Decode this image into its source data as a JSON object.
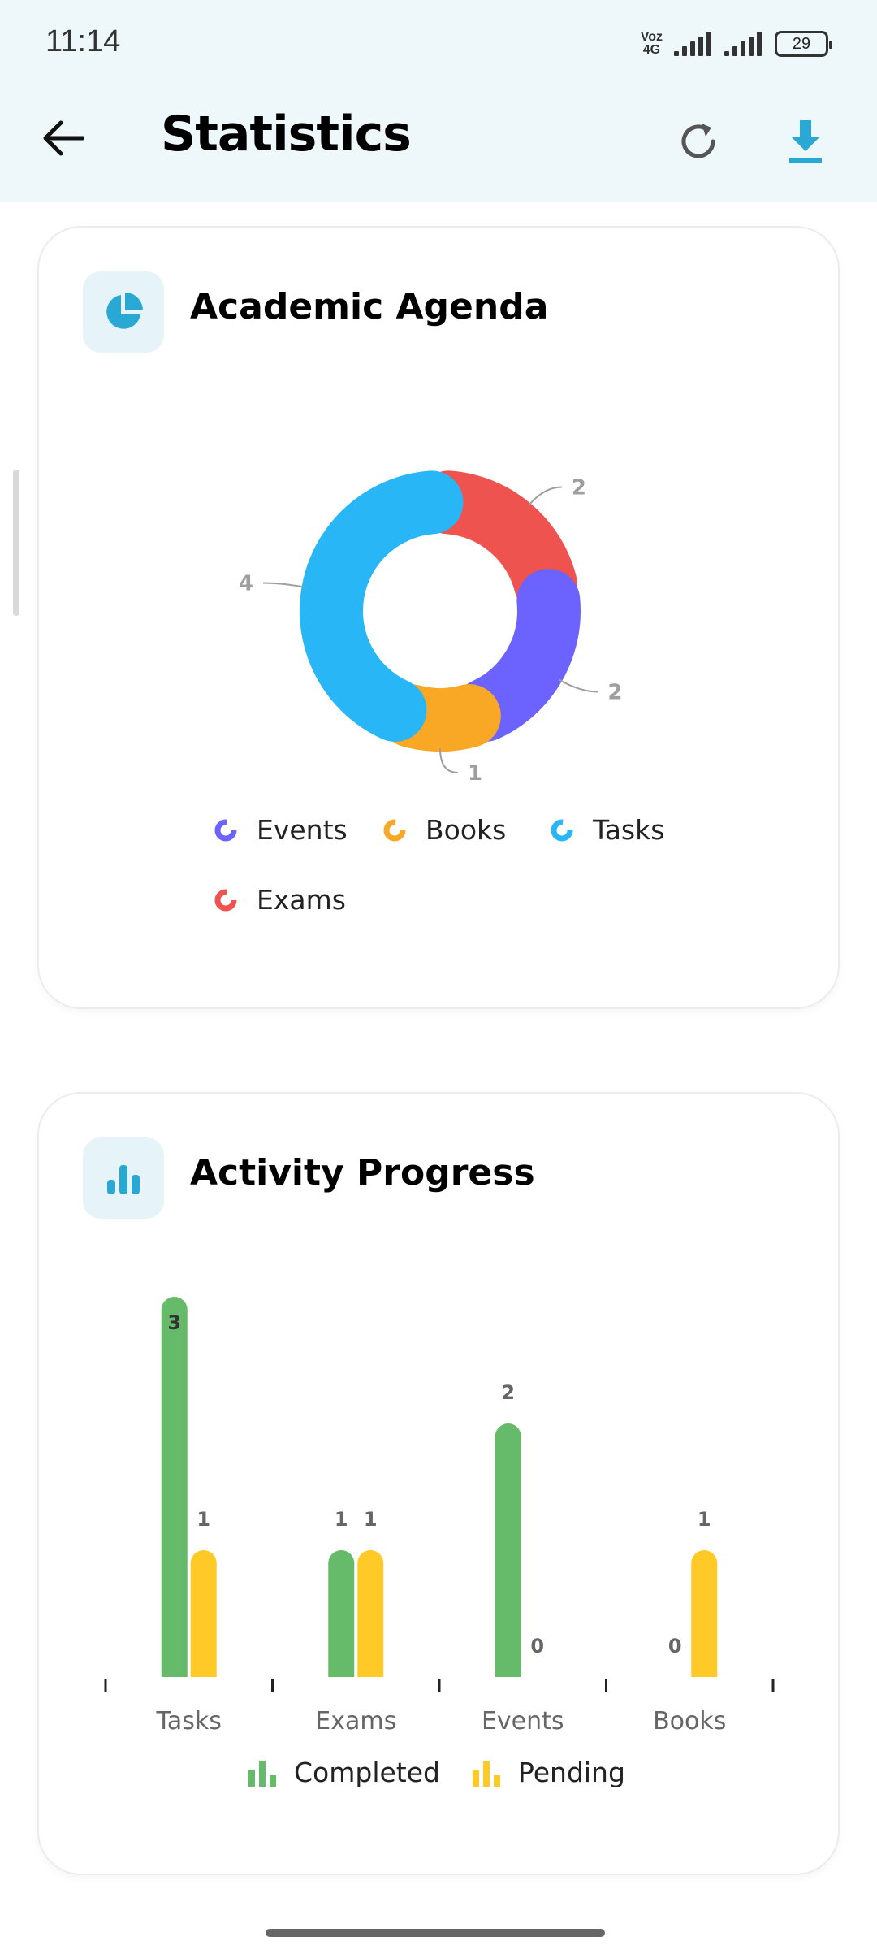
{
  "status_bar": {
    "time": "11:14",
    "network_top": "Voz",
    "network_bottom": "4G",
    "battery": "29"
  },
  "app_bar": {
    "title": "Statistics",
    "back_icon": "arrow-left-icon",
    "refresh_icon": "refresh-icon",
    "download_icon": "download-icon"
  },
  "colors": {
    "events": "#6c63ff",
    "books": "#f9a825",
    "tasks": "#29b6f6",
    "exams": "#ef5350",
    "completed": "#66bb6a",
    "pending": "#ffca28",
    "accent": "#29a8d4"
  },
  "agenda": {
    "title": "Academic Agenda",
    "icon": "pie-chart-icon",
    "legend": [
      "Events",
      "Books",
      "Tasks",
      "Exams"
    ]
  },
  "activity": {
    "title": "Activity Progress",
    "icon": "bar-chart-icon",
    "legend": [
      "Completed",
      "Pending"
    ]
  },
  "chart_data": [
    {
      "type": "pie",
      "subtype": "donut",
      "title": "Academic Agenda",
      "slices": [
        {
          "label": "Exams",
          "value": 2,
          "color": "#ef5350"
        },
        {
          "label": "Events",
          "value": 2,
          "color": "#6c63ff"
        },
        {
          "label": "Books",
          "value": 1,
          "color": "#f9a825"
        },
        {
          "label": "Tasks",
          "value": 4,
          "color": "#29b6f6"
        }
      ],
      "legend_position": "bottom"
    },
    {
      "type": "bar",
      "title": "Activity Progress",
      "categories": [
        "Tasks",
        "Exams",
        "Events",
        "Books"
      ],
      "series": [
        {
          "name": "Completed",
          "values": [
            3,
            1,
            2,
            0
          ],
          "color": "#66bb6a"
        },
        {
          "name": "Pending",
          "values": [
            1,
            1,
            0,
            1
          ],
          "color": "#ffca28"
        }
      ],
      "ylim": [
        0,
        3
      ],
      "grid": false,
      "legend_position": "bottom"
    }
  ]
}
